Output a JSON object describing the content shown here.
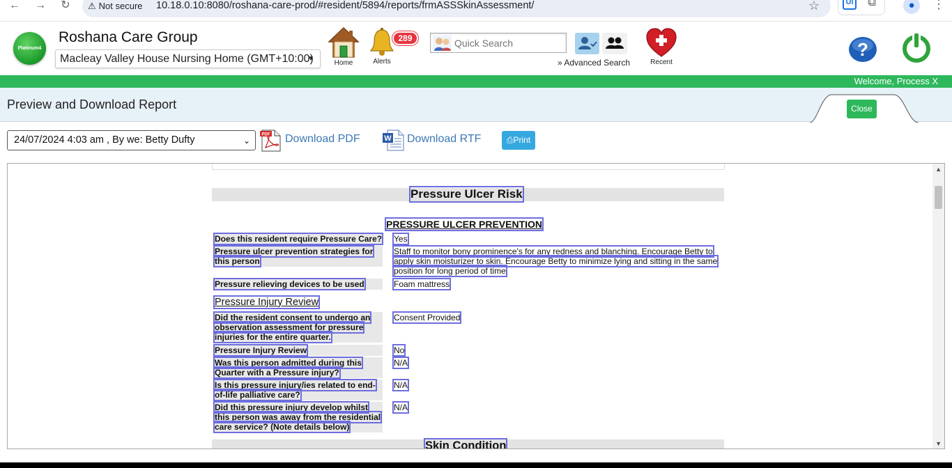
{
  "browser": {
    "security_label": "Not secure",
    "url": "10.18.0.10:8080/roshana-care-prod/#resident/5894/reports/frmASSSkinAssessment/",
    "ext_ui_label": "Ui"
  },
  "header": {
    "logo_text": "Platinum4",
    "org_name": "Roshana Care Group",
    "facility": "Macleay Valley House Nursing Home (GMT+10:00)",
    "home_label": "Home",
    "alerts_label": "Alerts",
    "alerts_count": "289",
    "quick_search_placeholder": "Quick Search",
    "advanced_search": "Advanced Search",
    "recent_label": "Recent"
  },
  "greenbar": {
    "welcome": "Welcome, Process X"
  },
  "page": {
    "title": "Preview and Download Report",
    "close_label": "Close"
  },
  "toolbar": {
    "version": "24/07/2024 4:03 am , By we: Betty Dufty",
    "download_pdf": "Download PDF",
    "download_rtf": "Download RTF",
    "print": "Print",
    "pdf_badge": "PDF"
  },
  "report": {
    "section_title": "Pressure Ulcer Risk",
    "subsection_title": "PRESSURE ULCER PREVENTION",
    "rows1": [
      {
        "q1": "Does this resident require Pressure Care?",
        "a1": "Yes"
      },
      {
        "q1": "Pressure ulcer prevention strategies for",
        "q2": "this person",
        "a1": "Staff to monitor bony prominence's for any redness and blanching. Encourage Betty to",
        "a2": "apply skin moisturizer to skin. Encourage Betty to minimize lying and sitting in the same",
        "a3": "position for long period of time"
      },
      {
        "q1": "Pressure relieving devices to be used",
        "a1": "Foam mattress"
      }
    ],
    "injury_review_heading": "Pressure Injury Review",
    "rows2": [
      {
        "q1": "Did the resident consent to undergo an",
        "q2": "observation assessment for pressure",
        "q3": "injuries for the entire quarter.",
        "a1": "Consent Provided"
      },
      {
        "q1": "Pressure Injury Review",
        "a1": "No"
      },
      {
        "q1": "Was this person admitted during this",
        "q2": "Quarter with a Pressure injury?",
        "a1": "N/A"
      },
      {
        "q1": "Is this pressure injury/ies related to end-",
        "q2": "of-life palliative care?",
        "a1": "N/A"
      },
      {
        "q1": "Did this pressure injury develop whilst",
        "q2": "this person was away from the residential",
        "q3": "care service? (Note details below)",
        "a1": "N/A"
      }
    ],
    "next_section_title": "Skin Condition"
  }
}
